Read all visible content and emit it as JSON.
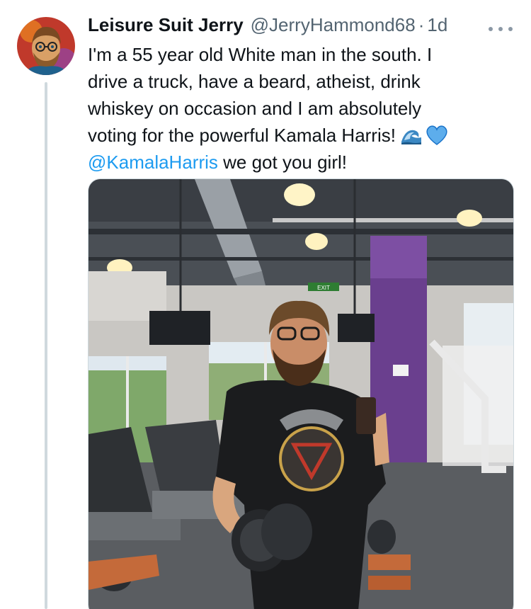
{
  "author": {
    "display_name": "Leisure Suit Jerry",
    "handle": "@JerryHammond68",
    "separator": "·",
    "time": "1d",
    "avatar_icon": "avatar-illustration-icon"
  },
  "tweet": {
    "lines": [
      "I'm a 55 year old White man in the south. I",
      "drive a truck, have a beard, atheist, drink",
      "whiskey on occasion and I am absolutely",
      "voting for the powerful Kamala Harris!"
    ],
    "mention": "@KamalaHarris",
    "mention_tail": " we got you girl!",
    "emojis": [
      "water-wave-emoji",
      "blue-heart-emoji"
    ]
  },
  "media": {
    "type": "photo",
    "content_icon": "gym-mirror-selfie-image",
    "exit_sign": "EXIT"
  },
  "colors": {
    "link": "#1d9bf0",
    "text": "#0f1419",
    "secondary": "#536471",
    "purple_column": "#6a3f8e"
  }
}
